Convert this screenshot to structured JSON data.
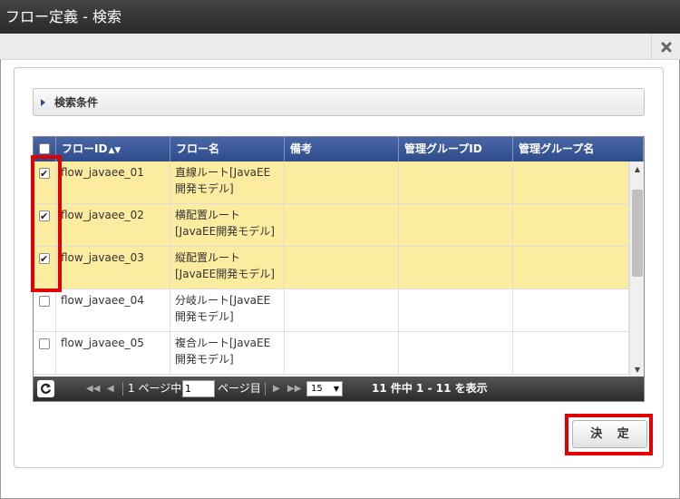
{
  "window": {
    "title": "フロー定義 - 検索"
  },
  "search": {
    "header_label": "検索条件"
  },
  "grid": {
    "columns": [
      "フローID",
      "フロー名",
      "備考",
      "管理グループID",
      "管理グループ名"
    ],
    "rows": [
      {
        "checked": true,
        "flow_id": "flow_javaee_01",
        "flow_name": "直線ルート[JavaEE開発モデル]",
        "note": "",
        "group_id": "",
        "group_name": ""
      },
      {
        "checked": true,
        "flow_id": "flow_javaee_02",
        "flow_name": "横配置ルート[JavaEE開発モデル]",
        "note": "",
        "group_id": "",
        "group_name": ""
      },
      {
        "checked": true,
        "flow_id": "flow_javaee_03",
        "flow_name": "縦配置ルート[JavaEE開発モデル]",
        "note": "",
        "group_id": "",
        "group_name": ""
      },
      {
        "checked": false,
        "flow_id": "flow_javaee_04",
        "flow_name": "分岐ルート[JavaEE開発モデル]",
        "note": "",
        "group_id": "",
        "group_name": ""
      },
      {
        "checked": false,
        "flow_id": "flow_javaee_05",
        "flow_name": "複合ルート[JavaEE開発モデル]",
        "note": "",
        "group_id": "",
        "group_name": ""
      }
    ]
  },
  "pager": {
    "total_pages_label": "1 ページ中",
    "page_value": "1",
    "page_suffix": "ページ目",
    "rows_per_page": "15",
    "summary": "11 件中 1 - 11 を表示"
  },
  "actions": {
    "decide_label": "決 定"
  },
  "colors": {
    "selected_row": "#fbeca0",
    "header_blue": "#2f4c8a",
    "highlight": "#e00000"
  }
}
